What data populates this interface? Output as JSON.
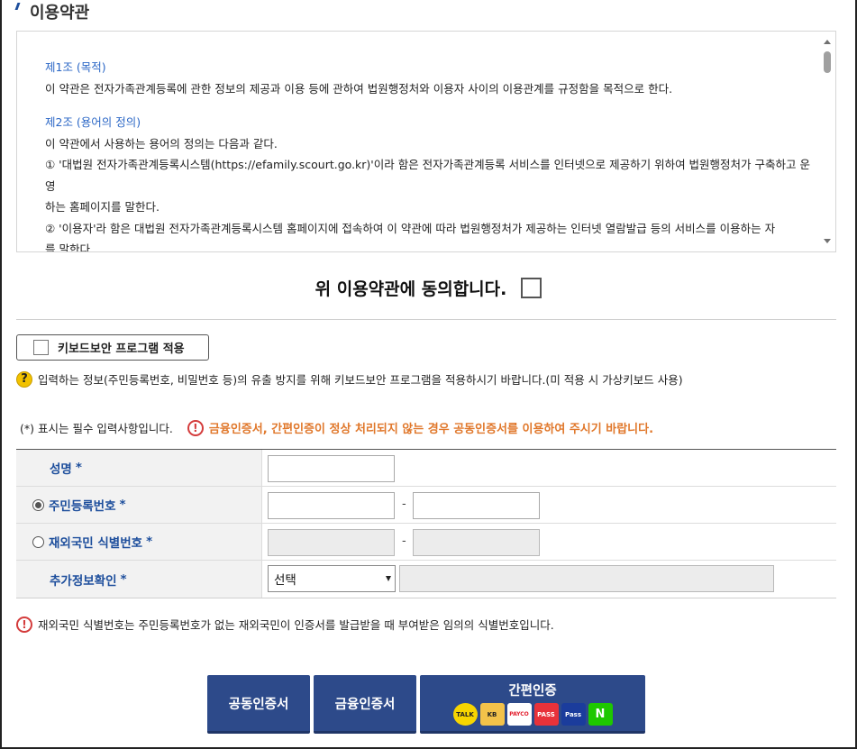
{
  "section": {
    "title": "이용약관"
  },
  "terms": {
    "art1_head": "제1조 (목적)",
    "art1_body": "이 약관은 전자가족관계등록에 관한 정보의 제공과 이용 등에 관하여 법원행정처와 이용자 사이의 이용관계를 규정함을 목적으로 한다.",
    "art2_head": "제2조 (용어의 정의)",
    "art2_intro": "이 약관에서 사용하는 용어의 정의는 다음과 같다.",
    "art2_item1_a": "① '대법원 전자가족관계등록시스템(https://efamily.scourt.go.kr)'이라 함은 전자가족관계등록 서비스를 인터넷으로 제공하기 위하여 법원행정처가 구축하고 운영",
    "art2_item1_b": "하는 홈페이지를 말한다.",
    "art2_item2_a": "② '이용자'라 함은 대법원 전자가족관계등록시스템 홈페이지에 접속하여 이 약관에 따라 법원행정처가 제공하는 인터넷 열람발급 등의 서비스를 이용하는 자",
    "art2_item2_b": "를 말한다."
  },
  "agree": {
    "label": "위 이용약관에 동의합니다."
  },
  "keyboard": {
    "button_label": "키보드보안 프로그램 적용",
    "note": "입력하는 정보(주민등록번호, 비밀번호 등)의 유출 방지를 위해 키보드보안 프로그램을 적용하시기 바랍니다.(미 적용 시 가상키보드 사용)"
  },
  "required_note": "(*) 표시는 필수 입력사항입니다.",
  "cert_warning": "금융인증서, 간편인증이 정상 처리되지 않는 경우 공동인증서를 이용하여 주시기 바랍니다.",
  "form": {
    "name_label": "성명",
    "rrn_label": "주민등록번호",
    "foreign_label": "재외국민 식별번호",
    "extra_label": "추가정보확인",
    "required_mark": "*",
    "dash": "-",
    "select_value": "선택"
  },
  "foreign_note": "재외국민 식별번호는 주민등록번호가 없는 재외국민이 인증서를 발급받을 때 부여받은 임의의 식별번호입니다.",
  "buttons": {
    "joint_cert": "공동인증서",
    "financial_cert": "금융인증서",
    "simple_auth": "간편인증"
  },
  "logos": {
    "talk": "TALK",
    "kb": "KB",
    "payco": "PAYCO",
    "pass": "PASS",
    "samsung_pass": "Pass",
    "naver": "N"
  },
  "colors": {
    "accent": "#1d4e9c",
    "button": "#2d4a8a",
    "warn": "#e0772a",
    "link": "#2b67c6"
  }
}
